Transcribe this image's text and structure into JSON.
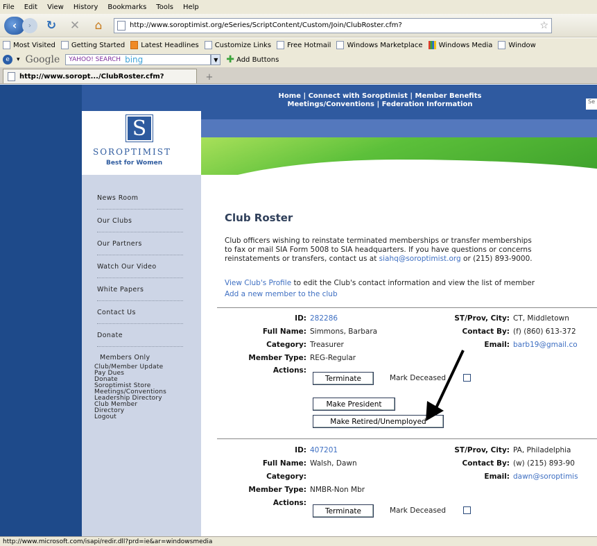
{
  "menubar": {
    "items": [
      "File",
      "Edit",
      "View",
      "History",
      "Bookmarks",
      "Tools",
      "Help"
    ]
  },
  "navbar": {
    "url": "http://www.soroptimist.org/eSeries/ScriptContent/Custom/Join/ClubRoster.cfm?"
  },
  "bookmarks": [
    "Most Visited",
    "Getting Started",
    "Latest Headlines",
    "Customize Links",
    "Free Hotmail",
    "Windows Marketplace",
    "Windows Media",
    "Window"
  ],
  "googlebar": {
    "brand": "Google",
    "search_brand": "YAHOO! SEARCH",
    "bing": "bing",
    "add_buttons": "Add Buttons"
  },
  "tab": {
    "title": "http://www.sоropt.../ClubRoster.cfm?",
    "new_tab": "+"
  },
  "header": {
    "line1": "Home | Connect with Soroptimist | Member Benefits",
    "line2": "Meetings/Conventions | Federation Information",
    "search_stub": "Se"
  },
  "logo": {
    "mark": "S",
    "word": "SOROPTIMIST",
    "tagline": "Best for Women"
  },
  "sidebar": {
    "links": [
      "News Room",
      "Our Clubs",
      "Our Partners",
      "Watch Our Video",
      "White Papers",
      "Contact Us",
      "Donate"
    ],
    "members_title": "Members Only",
    "members_links": [
      "Club/Member Update",
      "Pay Dues",
      "Donate",
      "Soroptimist Store",
      "Meetings/Conventions",
      "Leadership Directory",
      "Club Member",
      "Directory",
      "Logout"
    ]
  },
  "main": {
    "title": "Club Roster",
    "intro": [
      "Club officers wishing to reinstate terminated memberships or transfer memberships",
      "to fax or mail SIA Form 5008 to SIA headquarters. If you have questions or concerns",
      "reinstatements or transfers, contact us at"
    ],
    "intro_email": "siahq@soroptimist.org",
    "intro_tail": " or (215) 893-9000.",
    "profile_link": "View Club's Profile",
    "profile_tail": " to edit the Club's contact information and view the list of member",
    "add_member_link": "Add a new member to the club"
  },
  "labels": {
    "id": "ID:",
    "full_name": "Full Name:",
    "category": "Category:",
    "member_type": "Member Type:",
    "actions": "Actions:",
    "st_prov_city": "ST/Prov, City:",
    "contact_by": "Contact By:",
    "email": "Email:",
    "terminate": "Terminate",
    "mark_deceased": "Mark Deceased",
    "make_president": "Make President",
    "make_retired": "Make Retired/Unemployed"
  },
  "records": [
    {
      "id": "282286",
      "full_name": "Simmons, Barbara",
      "category": "Treasurer",
      "member_type": "REG-Regular",
      "st_prov_city": "CT, Middletown",
      "contact_by": "(f) (860) 613-372",
      "email": "barb19@gmail.co"
    },
    {
      "id": "407201",
      "full_name": "Walsh, Dawn",
      "category": "",
      "member_type": "NMBR-Non Mbr",
      "st_prov_city": "PA, Philadelphia",
      "contact_by": "(w) (215) 893-90",
      "email": "dawn@soroptimis"
    }
  ],
  "status": "http://www.microsoft.com/isapi/redir.dll?prd=ie&ar=windowsmedia"
}
